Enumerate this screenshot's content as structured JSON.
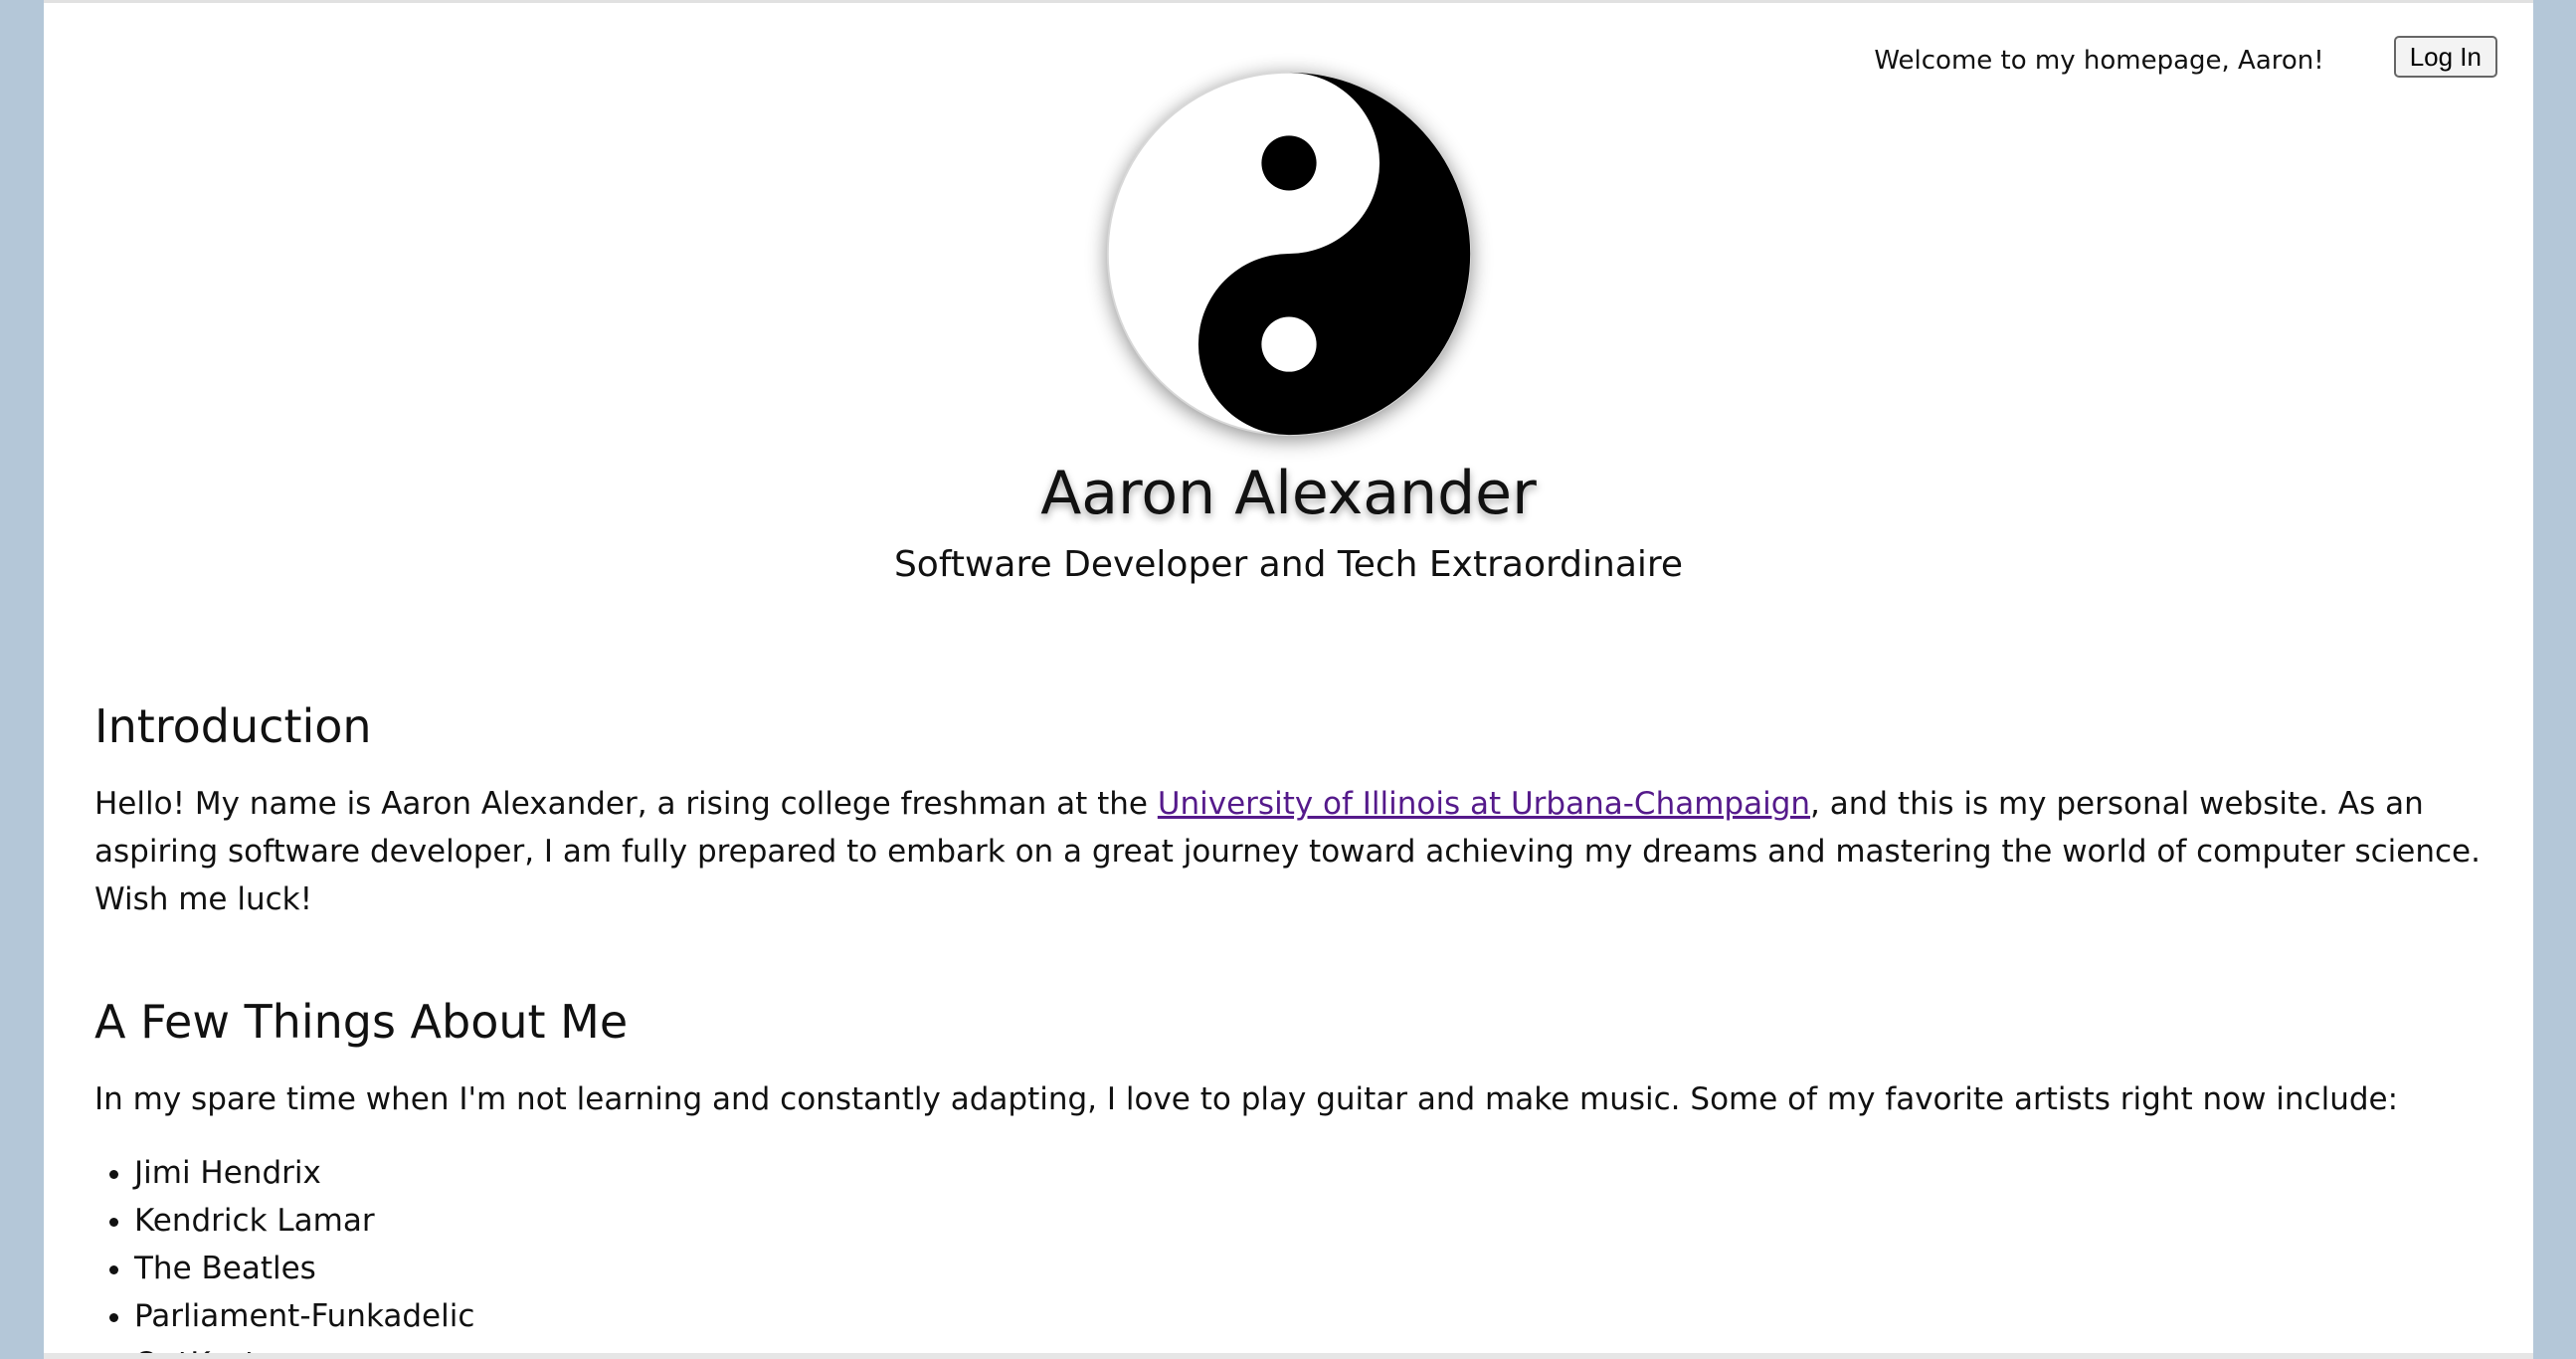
{
  "header": {
    "welcome_text": "Welcome to my homepage, Aaron!",
    "login_label": "Log In"
  },
  "profile": {
    "logo_icon": "yin-yang-icon",
    "name": "Aaron Alexander",
    "tagline": "Software Developer and Tech Extraordinaire"
  },
  "intro": {
    "heading": "Introduction",
    "text_before_link": "Hello! My name is Aaron Alexander, a rising college freshman at the ",
    "link_text": "University of Illinois at Urbana-Champaign",
    "text_after_link": ", and this is my personal website. As an aspiring software developer, I am fully prepared to embark on a great journey toward achieving my dreams and mastering the world of computer science. Wish me luck!"
  },
  "about": {
    "heading": "A Few Things About Me",
    "text": "In my spare time when I'm not learning and constantly adapting, I love to play guitar and make music. Some of my favorite artists right now include:",
    "artists": [
      "Jimi Hendrix",
      "Kendrick Lamar",
      "The Beatles",
      "Parliament-Funkadelic",
      "OutKast"
    ]
  },
  "colors": {
    "side_background": "#b4c7d8",
    "link_visited": "#551a8b"
  }
}
